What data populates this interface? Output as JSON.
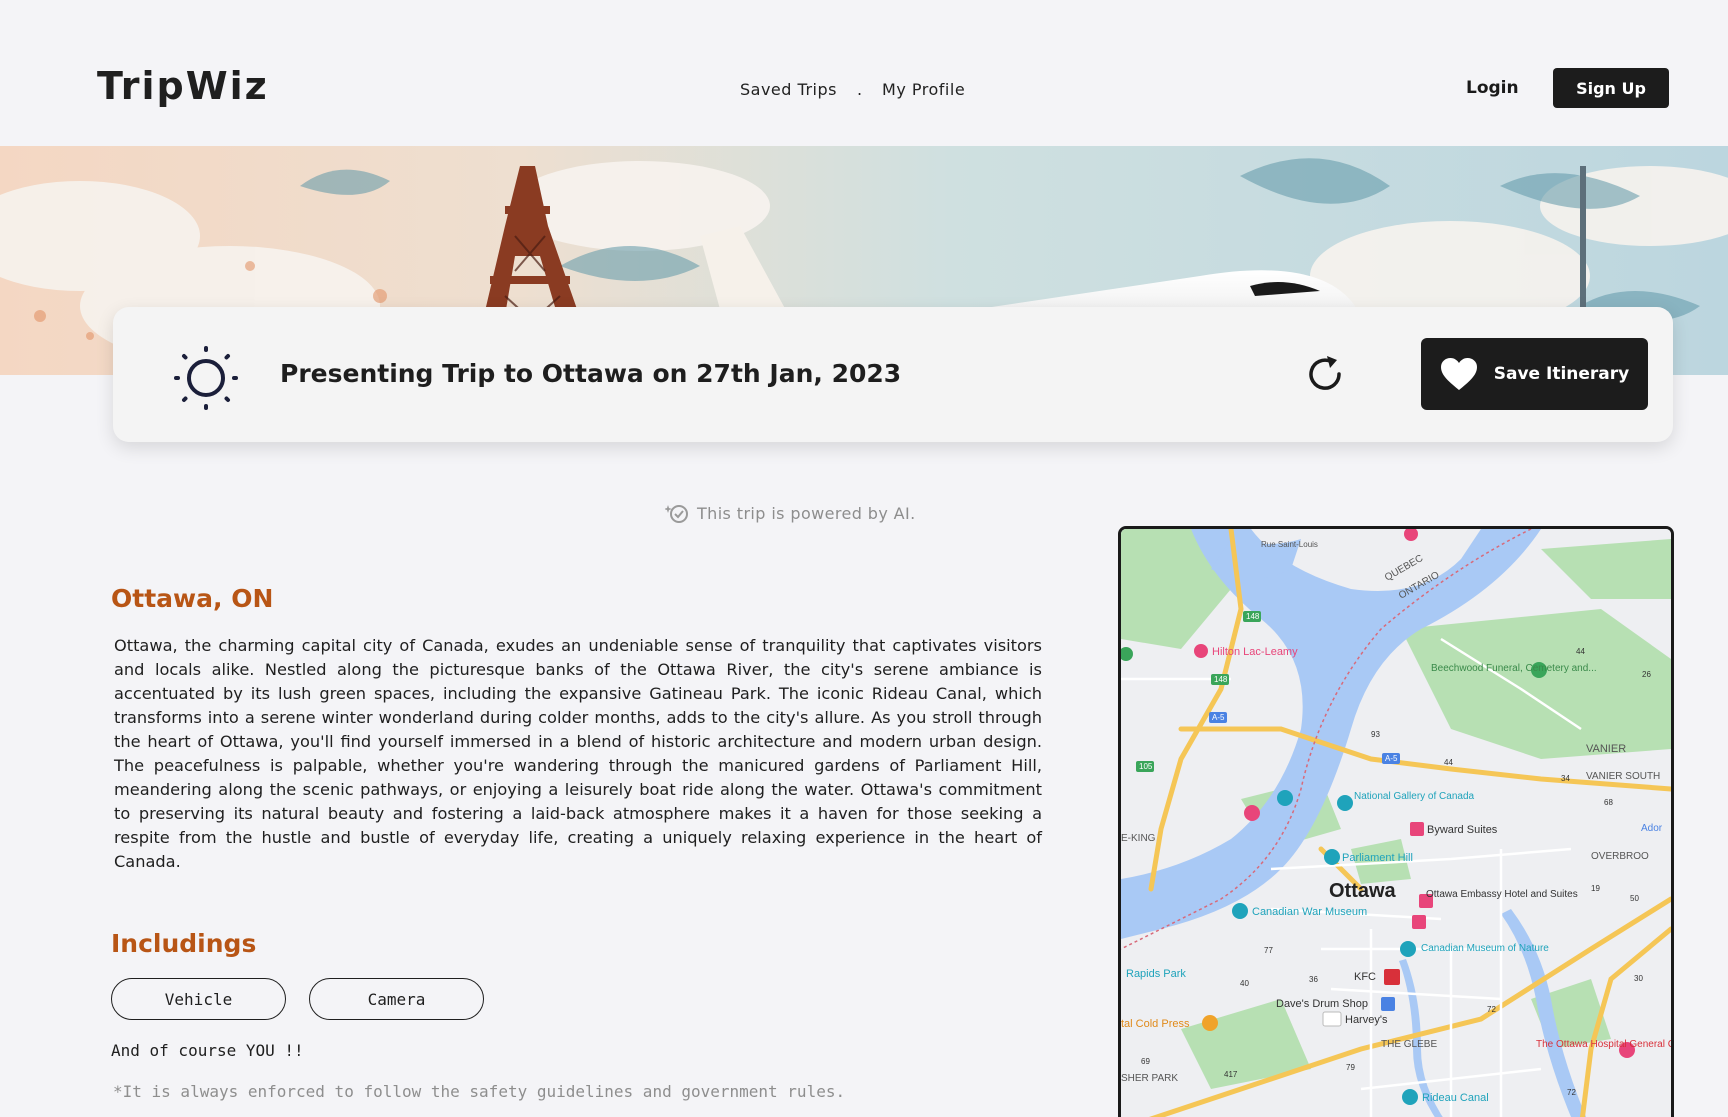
{
  "header": {
    "logo": "TripWiz",
    "nav": [
      {
        "label": "Saved Trips"
      },
      {
        "label": "My Profile"
      }
    ],
    "nav_separator": ".",
    "login_label": "Login",
    "signup_label": "Sign Up"
  },
  "trip_card": {
    "title": "Presenting Trip to Ottawa on 27th Jan, 2023",
    "save_label": "Save Itinerary"
  },
  "powered_by": "This trip is powered by AI.",
  "content": {
    "city_title": "Ottawa, ON",
    "description": "Ottawa, the charming capital city of Canada, exudes an undeniable sense of tranquility that captivates visitors and locals alike. Nestled along the picturesque banks of the Ottawa River, the city's serene ambiance is accentuated by its lush green spaces, including the expansive Gatineau Park. The iconic Rideau Canal, which transforms into a serene winter wonderland during colder months, adds to the city's allure. As you stroll through the heart of Ottawa, you'll find yourself immersed in a blend of historic architecture and modern urban design. The peacefulness is palpable, whether you're wandering through the manicured gardens of Parliament Hill, meandering along the scenic pathways, or enjoying a leisurely boat ride along the water. Ottawa's commitment to preserving its natural beauty and fostering a laid-back atmosphere makes it a haven for those seeking a respite from the hustle and bustle of everyday life, creating a uniquely relaxing experience in the heart of Canada.",
    "includings_title": "Includings",
    "includings": [
      "Vehicle",
      "Camera"
    ],
    "and_you": "And of course YOU !!",
    "note": "*It is always  enforced to follow the  safety guidelines and government rules."
  },
  "map": {
    "city": "Ottawa",
    "places": [
      {
        "name": "Rue Saint-Louis"
      },
      {
        "name": "Hilton Lac-Leamy"
      },
      {
        "name": "QUEBEC"
      },
      {
        "name": "ONTARIO"
      },
      {
        "name": "Beechwood Funeral, Cemetery and..."
      },
      {
        "name": "VANIER"
      },
      {
        "name": "VANIER SOUTH"
      },
      {
        "name": "National Gallery of Canada"
      },
      {
        "name": "Byward Suites"
      },
      {
        "name": "Parliament Hill"
      },
      {
        "name": "E-KING"
      },
      {
        "name": "Ottawa Embassy Hotel and Suites"
      },
      {
        "name": "Canadian War Museum"
      },
      {
        "name": "Canadian Museum of Nature"
      },
      {
        "name": "OVERBROO"
      },
      {
        "name": "Ador"
      },
      {
        "name": "Rapids Park"
      },
      {
        "name": "KFC"
      },
      {
        "name": "Dave's Drum Shop"
      },
      {
        "name": "Harvey's"
      },
      {
        "name": "tal Cold Press"
      },
      {
        "name": "THE GLEBE"
      },
      {
        "name": "The Ottawa Hospital General Campus"
      },
      {
        "name": "SHER PARK"
      },
      {
        "name": "Rideau Canal"
      }
    ],
    "road_numbers": [
      "148",
      "148",
      "A-5",
      "A-5",
      "105",
      "93",
      "44",
      "44",
      "34",
      "68",
      "26",
      "19",
      "50",
      "72",
      "30",
      "40",
      "36",
      "77",
      "79",
      "69",
      "417",
      "72"
    ],
    "colors": {
      "water": "#a9c9f5",
      "park": "#b7e0b3",
      "road": "#f5c656",
      "land": "#eeeff2",
      "pin_hotel": "#e8457a",
      "pin_attraction": "#1fa3bb"
    }
  },
  "colors": {
    "accent_orange": "#b85515",
    "button_dark": "#1c1c1c",
    "background": "#f4f4f7"
  }
}
